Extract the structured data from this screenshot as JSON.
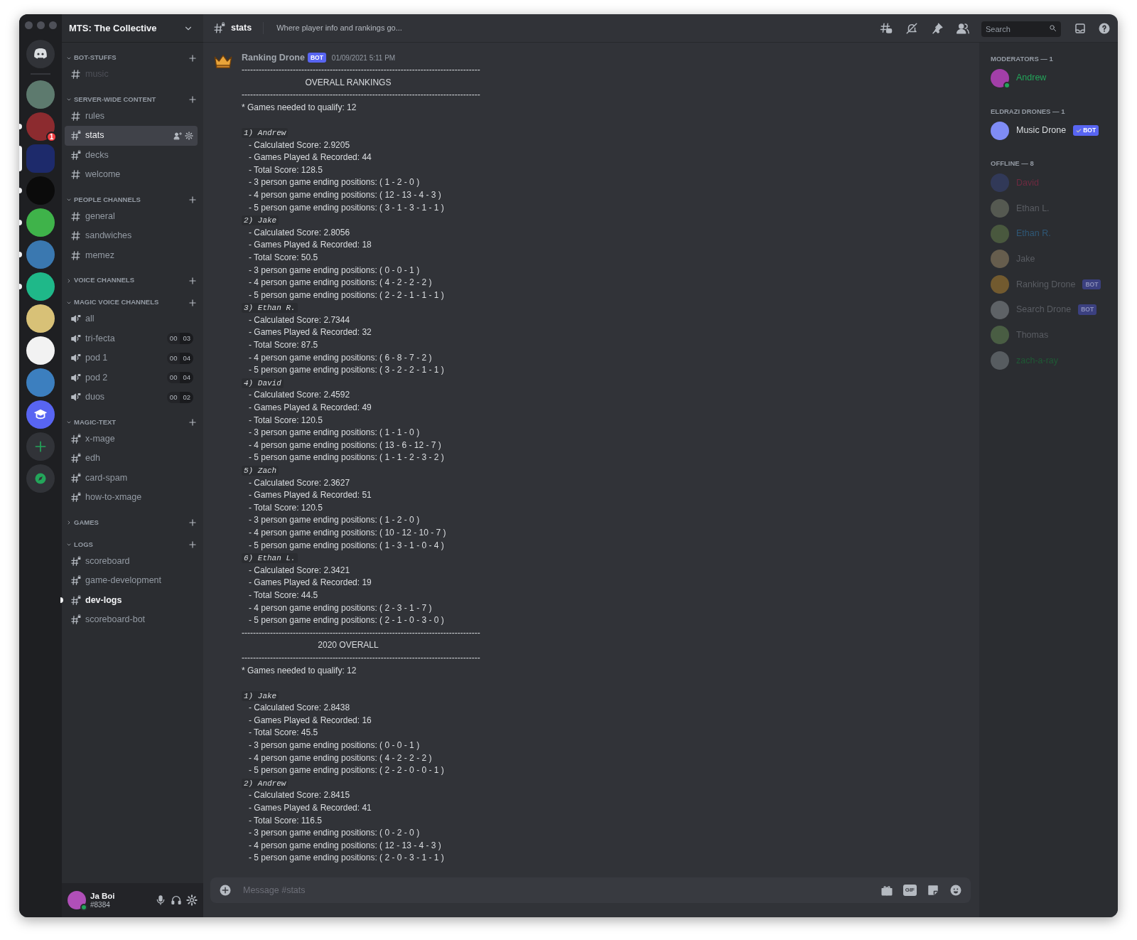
{
  "servers": [
    {
      "kind": "home",
      "color": "#313338",
      "selected": false,
      "unread": false
    },
    {
      "kind": "server",
      "color": "#5d7a6e",
      "selected": false,
      "unread": false
    },
    {
      "kind": "server",
      "color": "#8c2b2f",
      "selected": false,
      "unread": true,
      "badge": "1"
    },
    {
      "kind": "server",
      "color": "#1d2a6b",
      "selected": true,
      "unread": false
    },
    {
      "kind": "server",
      "color": "#0b0b0b",
      "selected": false,
      "unread": true
    },
    {
      "kind": "server",
      "color": "#3fb34a",
      "selected": false,
      "unread": true
    },
    {
      "kind": "server",
      "color": "#3a78b0",
      "selected": false,
      "unread": true
    },
    {
      "kind": "server",
      "color": "#1fb889",
      "selected": false,
      "unread": true
    },
    {
      "kind": "server",
      "color": "#d8c177",
      "selected": false,
      "unread": false
    },
    {
      "kind": "server",
      "color": "#f2f2f2",
      "selected": false,
      "unread": false
    },
    {
      "kind": "server",
      "color": "#3c7fbf",
      "selected": false,
      "unread": false
    },
    {
      "kind": "school",
      "color": "#5865f2",
      "selected": false,
      "unread": false
    },
    {
      "kind": "add",
      "color": "#313338",
      "selected": false,
      "unread": false
    },
    {
      "kind": "explore",
      "color": "#313338",
      "selected": false,
      "unread": false
    }
  ],
  "guild": {
    "name": "MTS: The Collective"
  },
  "categories": [
    {
      "name": "BOT-STUFFS",
      "expanded": true,
      "channels": [
        {
          "name": "music",
          "kind": "text",
          "locked": false,
          "selected": false,
          "unread": false,
          "muted": true
        }
      ]
    },
    {
      "name": "SERVER-WIDE CONTENT",
      "expanded": true,
      "channels": [
        {
          "name": "rules",
          "kind": "text",
          "locked": false,
          "selected": false,
          "unread": false,
          "muted": false
        },
        {
          "name": "stats",
          "kind": "text",
          "locked": true,
          "selected": true,
          "unread": false,
          "muted": false
        },
        {
          "name": "decks",
          "kind": "text",
          "locked": true,
          "selected": false,
          "unread": false,
          "muted": false
        },
        {
          "name": "welcome",
          "kind": "text",
          "locked": false,
          "selected": false,
          "unread": false,
          "muted": false
        }
      ]
    },
    {
      "name": "PEOPLE CHANNELS",
      "expanded": true,
      "channels": [
        {
          "name": "general",
          "kind": "text",
          "locked": false,
          "selected": false,
          "unread": false,
          "muted": false
        },
        {
          "name": "sandwiches",
          "kind": "text",
          "locked": false,
          "selected": false,
          "unread": false,
          "muted": false
        },
        {
          "name": "memez",
          "kind": "text",
          "locked": false,
          "selected": false,
          "unread": false,
          "muted": false
        }
      ]
    },
    {
      "name": "VOICE CHANNELS",
      "expanded": false
    },
    {
      "name": "MAGIC VOICE CHANNELS",
      "expanded": true,
      "channels": [
        {
          "name": "all",
          "kind": "voice",
          "locked": true,
          "selected": false,
          "unread": false,
          "muted": false
        },
        {
          "name": "tri-fecta",
          "kind": "voice",
          "locked": true,
          "selected": false,
          "unread": false,
          "muted": false,
          "users": "00",
          "limit": "03"
        },
        {
          "name": "pod 1",
          "kind": "voice",
          "locked": true,
          "selected": false,
          "unread": false,
          "muted": false,
          "users": "00",
          "limit": "04"
        },
        {
          "name": "pod 2",
          "kind": "voice",
          "locked": true,
          "selected": false,
          "unread": false,
          "muted": false,
          "users": "00",
          "limit": "04"
        },
        {
          "name": "duos",
          "kind": "voice",
          "locked": true,
          "selected": false,
          "unread": false,
          "muted": false,
          "users": "00",
          "limit": "02"
        }
      ]
    },
    {
      "name": "MAGIC-TEXT",
      "expanded": true,
      "channels": [
        {
          "name": "x-mage",
          "kind": "text",
          "locked": true,
          "selected": false,
          "unread": false,
          "muted": false
        },
        {
          "name": "edh",
          "kind": "text",
          "locked": true,
          "selected": false,
          "unread": false,
          "muted": false
        },
        {
          "name": "card-spam",
          "kind": "text",
          "locked": true,
          "selected": false,
          "unread": false,
          "muted": false
        },
        {
          "name": "how-to-xmage",
          "kind": "text",
          "locked": true,
          "selected": false,
          "unread": false,
          "muted": false
        }
      ]
    },
    {
      "name": "GAMES",
      "expanded": false
    },
    {
      "name": "LOGS",
      "expanded": true,
      "channels": [
        {
          "name": "scoreboard",
          "kind": "text",
          "locked": true,
          "selected": false,
          "unread": false,
          "muted": false
        },
        {
          "name": "game-development",
          "kind": "text",
          "locked": true,
          "selected": false,
          "unread": false,
          "muted": false
        },
        {
          "name": "dev-logs",
          "kind": "text",
          "locked": true,
          "selected": false,
          "unread": true,
          "muted": false
        },
        {
          "name": "scoreboard-bot",
          "kind": "text",
          "locked": true,
          "selected": false,
          "unread": false,
          "muted": false
        }
      ]
    }
  ],
  "user_panel": {
    "name": "Ja Boi",
    "tag": "#8384"
  },
  "header": {
    "channel": "stats",
    "topic": "Where player info and rankings go...",
    "search_placeholder": "Search"
  },
  "message": {
    "author": "Ranking Drone",
    "bot_tag": "BOT",
    "timestamp": "01/09/2021 5:11 PM",
    "lines": [
      {
        "kind": "rule",
        "text": "------------------------------------------------------------------------------------"
      },
      {
        "kind": "heading",
        "text": "OVERALL RANKINGS"
      },
      {
        "kind": "rule",
        "text": "------------------------------------------------------------------------------------"
      },
      {
        "kind": "note",
        "text": "* Games needed to qualify: 12"
      },
      {
        "kind": "blank"
      },
      {
        "kind": "rank",
        "text": "1) Andrew"
      },
      {
        "kind": "item",
        "text": "- Calculated Score: 2.9205"
      },
      {
        "kind": "item",
        "text": "- Games Played & Recorded: 44"
      },
      {
        "kind": "item",
        "text": "- Total Score: 128.5"
      },
      {
        "kind": "item",
        "text": "- 3 person game ending positions: ( 1 - 2 - 0 )"
      },
      {
        "kind": "item",
        "text": "- 4 person game ending positions: ( 12 - 13 - 4 - 3 )"
      },
      {
        "kind": "item",
        "text": "- 5 person game ending positions: ( 3 - 1 - 3 - 1 - 1 )"
      },
      {
        "kind": "rank",
        "text": "2) Jake"
      },
      {
        "kind": "item",
        "text": "- Calculated Score: 2.8056"
      },
      {
        "kind": "item",
        "text": "- Games Played & Recorded: 18"
      },
      {
        "kind": "item",
        "text": "- Total Score: 50.5"
      },
      {
        "kind": "item",
        "text": "- 3 person game ending positions: ( 0 - 0 - 1 )"
      },
      {
        "kind": "item",
        "text": "- 4 person game ending positions: ( 4 - 2 - 2 - 2 )"
      },
      {
        "kind": "item",
        "text": "- 5 person game ending positions: ( 2 - 2 - 1 - 1 - 1 )"
      },
      {
        "kind": "rank",
        "text": "3) Ethan R."
      },
      {
        "kind": "item",
        "text": "- Calculated Score: 2.7344"
      },
      {
        "kind": "item",
        "text": "- Games Played & Recorded: 32"
      },
      {
        "kind": "item",
        "text": "- Total Score: 87.5"
      },
      {
        "kind": "item",
        "text": "- 4 person game ending positions: ( 6 - 8 - 7 - 2 )"
      },
      {
        "kind": "item",
        "text": "- 5 person game ending positions: ( 3 - 2 - 2 - 1 - 1 )"
      },
      {
        "kind": "rank",
        "text": "4) David"
      },
      {
        "kind": "item",
        "text": "- Calculated Score: 2.4592"
      },
      {
        "kind": "item",
        "text": "- Games Played & Recorded: 49"
      },
      {
        "kind": "item",
        "text": "- Total Score: 120.5"
      },
      {
        "kind": "item",
        "text": "- 3 person game ending positions: ( 1 - 1 - 0 )"
      },
      {
        "kind": "item",
        "text": "- 4 person game ending positions: ( 13 - 6 - 12 - 7 )"
      },
      {
        "kind": "item",
        "text": "- 5 person game ending positions: ( 1 - 1 - 2 - 3 - 2 )"
      },
      {
        "kind": "rank",
        "text": "5) Zach"
      },
      {
        "kind": "item",
        "text": "- Calculated Score: 2.3627"
      },
      {
        "kind": "item",
        "text": "- Games Played & Recorded: 51"
      },
      {
        "kind": "item",
        "text": "- Total Score: 120.5"
      },
      {
        "kind": "item",
        "text": "- 3 person game ending positions: ( 1 - 2 - 0 )"
      },
      {
        "kind": "item",
        "text": "- 4 person game ending positions: ( 10 - 12 - 10 - 7 )"
      },
      {
        "kind": "item",
        "text": "- 5 person game ending positions: ( 1 - 3 - 1 - 0 - 4 )"
      },
      {
        "kind": "rank",
        "text": "6) Ethan L."
      },
      {
        "kind": "item",
        "text": "- Calculated Score: 2.3421"
      },
      {
        "kind": "item",
        "text": "- Games Played & Recorded: 19"
      },
      {
        "kind": "item",
        "text": "- Total Score: 44.5"
      },
      {
        "kind": "item",
        "text": "- 4 person game ending positions: ( 2 - 3 - 1 - 7 )"
      },
      {
        "kind": "item",
        "text": "- 5 person game ending positions: ( 2 - 1 - 0 - 3 - 0 )"
      },
      {
        "kind": "rule",
        "text": "------------------------------------------------------------------------------------"
      },
      {
        "kind": "heading",
        "text": "2020 OVERALL"
      },
      {
        "kind": "rule",
        "text": "------------------------------------------------------------------------------------"
      },
      {
        "kind": "note",
        "text": "* Games needed to qualify: 12"
      },
      {
        "kind": "blank"
      },
      {
        "kind": "rank",
        "text": "1) Jake"
      },
      {
        "kind": "item",
        "text": "- Calculated Score: 2.8438"
      },
      {
        "kind": "item",
        "text": "- Games Played & Recorded: 16"
      },
      {
        "kind": "item",
        "text": "- Total Score: 45.5"
      },
      {
        "kind": "item",
        "text": "- 3 person game ending positions: ( 0 - 0 - 1 )"
      },
      {
        "kind": "item",
        "text": "- 4 person game ending positions: ( 4 - 2 - 2 - 2 )"
      },
      {
        "kind": "item",
        "text": "- 5 person game ending positions: ( 2 - 2 - 0 - 0 - 1 )"
      },
      {
        "kind": "rank",
        "text": "2) Andrew"
      },
      {
        "kind": "item",
        "text": "- Calculated Score: 2.8415"
      },
      {
        "kind": "item",
        "text": "- Games Played & Recorded: 41"
      },
      {
        "kind": "item",
        "text": "- Total Score: 116.5"
      },
      {
        "kind": "item",
        "text": "- 3 person game ending positions: ( 0 - 2 - 0 )"
      },
      {
        "kind": "item",
        "text": "- 4 person game ending positions: ( 12 - 13 - 4 - 3 )"
      },
      {
        "kind": "item",
        "text": "- 5 person game ending positions: ( 2 - 0 - 3 - 1 - 1 )"
      }
    ]
  },
  "composer": {
    "placeholder": "Message #stats",
    "gif_label": "GIF"
  },
  "member_groups": [
    {
      "title": "MODERATORS — 1",
      "offline": false,
      "members": [
        {
          "name": "Andrew",
          "color": "#23a55a",
          "online_dot": true
        }
      ]
    },
    {
      "title": "ELDRAZI DRONES — 1",
      "offline": false,
      "members": [
        {
          "name": "Music Drone",
          "color": "#dbdee1",
          "online_dot": false,
          "bot_tag": "BOT",
          "verified": true
        }
      ]
    },
    {
      "title": "OFFLINE — 8",
      "offline": true,
      "members": [
        {
          "name": "David",
          "color": "#6e2a40",
          "online_dot": false
        },
        {
          "name": "Ethan L.",
          "color": "#5a5d63",
          "online_dot": false
        },
        {
          "name": "Ethan R.",
          "color": "#2f5877",
          "online_dot": false
        },
        {
          "name": "Jake",
          "color": "#5a5d63",
          "online_dot": false
        },
        {
          "name": "Ranking Drone",
          "color": "#5a5d63",
          "online_dot": false,
          "bot_tag": "BOT",
          "verified": false
        },
        {
          "name": "Search Drone",
          "color": "#5a5d63",
          "online_dot": false,
          "bot_tag": "BOT",
          "verified": false
        },
        {
          "name": "Thomas",
          "color": "#5a5d63",
          "online_dot": false
        },
        {
          "name": "zach-a-ray",
          "color": "#1f5a35",
          "online_dot": false
        }
      ]
    }
  ]
}
